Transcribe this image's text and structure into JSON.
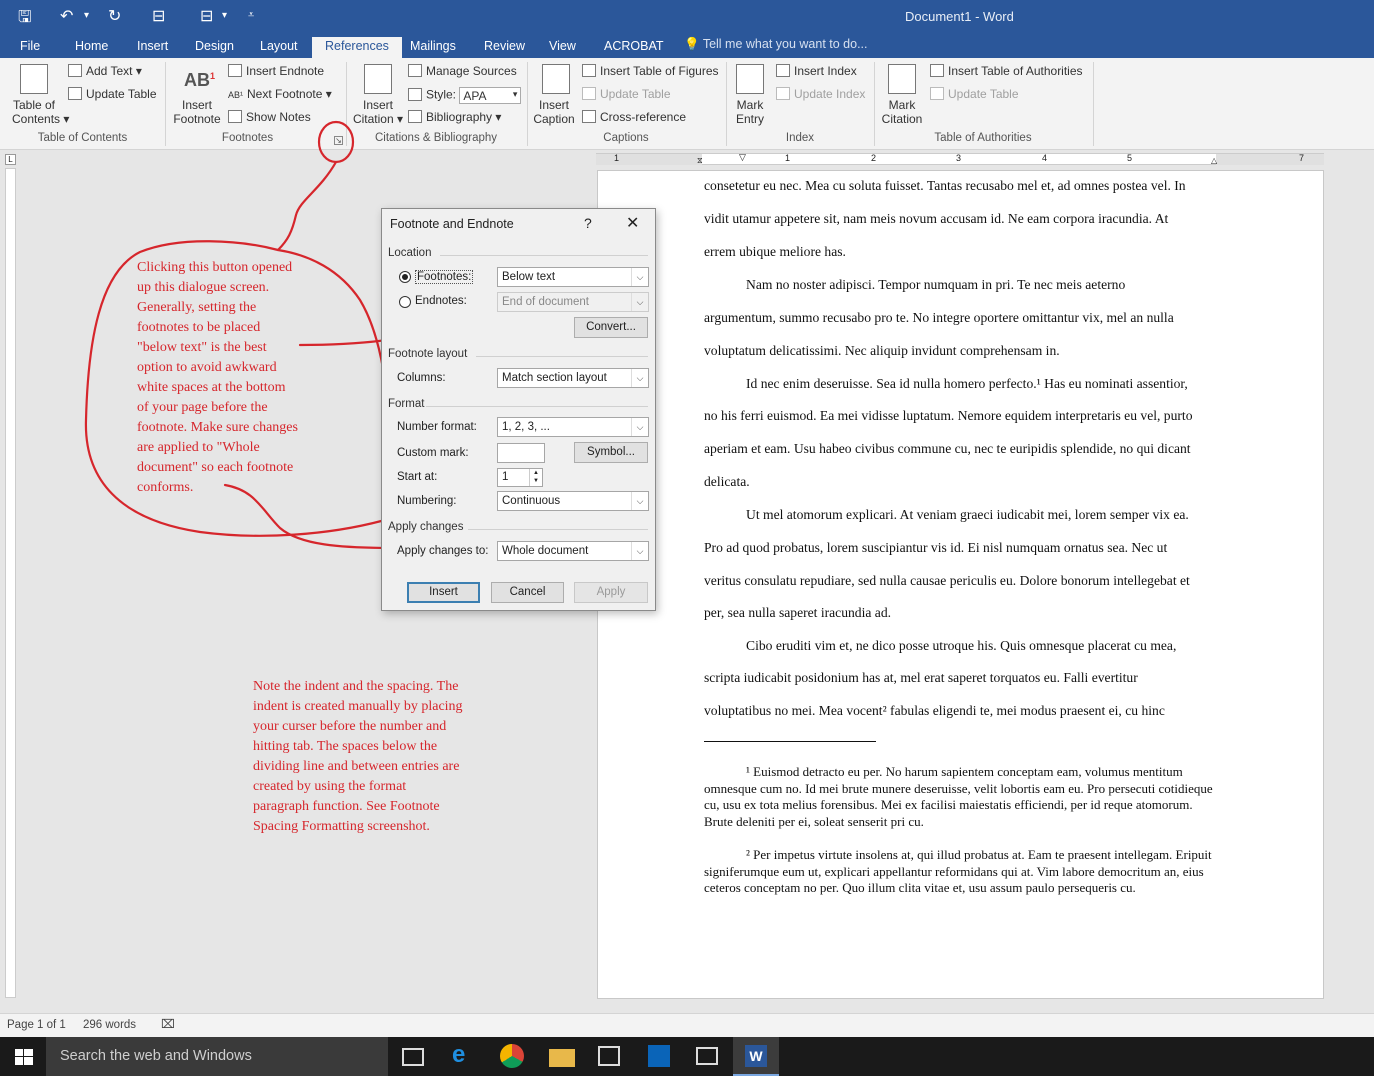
{
  "window": {
    "title": "Document1 - Word"
  },
  "menu_tabs": [
    "File",
    "Home",
    "Insert",
    "Design",
    "Layout",
    "References",
    "Mailings",
    "Review",
    "View",
    "ACROBAT"
  ],
  "active_tab": "References",
  "tell_me": "Tell me what you want to do...",
  "ribbon": {
    "toc": {
      "line1": "Table of",
      "line2": "Contents",
      "add_text": "Add Text",
      "update_table": "Update Table",
      "group": "Table of Contents"
    },
    "footnotes": {
      "insert_line1": "Insert",
      "insert_line2": "Footnote",
      "insert_endnote": "Insert Endnote",
      "next_footnote": "Next Footnote",
      "show_notes": "Show Notes",
      "group": "Footnotes"
    },
    "citations": {
      "insert_line1": "Insert",
      "insert_line2": "Citation",
      "manage_sources": "Manage Sources",
      "style_label": "Style:",
      "style_value": "APA",
      "bibliography": "Bibliography",
      "group": "Citations & Bibliography"
    },
    "captions": {
      "insert_line1": "Insert",
      "insert_line2": "Caption",
      "insert_tof": "Insert Table of Figures",
      "update_table": "Update Table",
      "cross_reference": "Cross-reference",
      "group": "Captions"
    },
    "index": {
      "mark_line1": "Mark",
      "mark_line2": "Entry",
      "insert_index": "Insert Index",
      "update_index": "Update Index",
      "group": "Index"
    },
    "toa": {
      "mark_line1": "Mark",
      "mark_line2": "Citation",
      "insert_toa": "Insert Table of Authorities",
      "update_table": "Update Table",
      "group": "Table of Authorities"
    }
  },
  "ruler_numbers": [
    "1",
    "1",
    "2",
    "3",
    "4",
    "5",
    "7"
  ],
  "dialog": {
    "title": "Footnote and Endnote",
    "help": "?",
    "close": "✕",
    "location_label": "Location",
    "footnotes_label": "Footnotes:",
    "footnotes_value": "Below text",
    "endnotes_label": "Endnotes:",
    "endnotes_value": "End of document",
    "convert_button": "Convert...",
    "layout_label": "Footnote layout",
    "columns_label": "Columns:",
    "columns_value": "Match section layout",
    "format_label": "Format",
    "number_format_label": "Number format:",
    "number_format_value": "1, 2, 3, ...",
    "custom_mark_label": "Custom mark:",
    "custom_mark_value": "",
    "symbol_button": "Symbol...",
    "start_at_label": "Start at:",
    "start_at_value": "1",
    "numbering_label": "Numbering:",
    "numbering_value": "Continuous",
    "apply_changes_label": "Apply changes",
    "apply_to_label": "Apply changes to:",
    "apply_to_value": "Whole document",
    "insert_button": "Insert",
    "cancel_button": "Cancel",
    "apply_button": "Apply"
  },
  "document": {
    "lines": [
      "consetetur eu nec. Mea cu soluta fuisset. Tantas recusabo mel et, ad omnes postea vel. In",
      "vidit utamur appetere sit, nam meis novum accusam id. Ne eam corpora iracundia. At",
      "errem ubique meliore has.",
      "Nam no noster adipisci. Tempor numquam in pri. Te nec meis aeterno",
      "argumentum, summo recusabo pro te. No integre oportere omittantur vix, mel an nulla",
      "voluptatum delicatissimi. Nec aliquip invidunt comprehensam in.",
      "Id nec enim deseruisse. Sea id nulla homero perfecto.¹ Has eu nominati assentior,",
      "no his ferri euismod. Ea mei vidisse luptatum. Nemore equidem interpretaris eu vel, purto",
      "aperiam et eam. Usu habeo civibus commune cu, nec te euripidis splendide, no qui dicant",
      "delicata.",
      "Ut mel atomorum explicari. At veniam graeci iudicabit mei, lorem semper vix ea.",
      "Pro ad quod probatus, lorem suscipiantur vis id. Ei nisl numquam ornatus sea. Nec ut",
      "veritus consulatu repudiare, sed nulla causae periculis eu. Dolore bonorum intellegebat et",
      "per, sea nulla saperet iracundia ad.",
      "Cibo eruditi vim et, ne dico posse utroque his. Quis omnesque placerat cu mea,",
      "scripta iudicabit posidonium has at, mel erat saperet torquatos eu. Falli evertitur",
      "voluptatibus no mei. Mea vocent² fabulas eligendi te, mei modus praesent ei, cu hinc"
    ],
    "footnote1": "¹ Euismod detracto eu per. No harum sapientem conceptam eam, volumus mentitum omnesque cum no. Id mei brute munere deseruisse, velit lobortis eam eu. Pro persecuti cotidieque cu, usu ex tota melius forensibus. Mei ex facilisi maiestatis efficiendi, per id reque atomorum. Brute deleniti per ei, soleat senserit pri cu.",
    "footnote2": "² Per impetus virtute insolens at, qui illud probatus at. Eam te praesent intellegam. Eripuit signiferumque eum ut, explicari appellantur reformidans qui at. Vim labore democritum an, eius ceteros conceptam no per. Quo illum clita vitae et, usu assum paulo persequeris cu."
  },
  "annotations": {
    "note1": [
      "Clicking this button opened",
      "up this dialogue screen.",
      "Generally, setting the",
      "footnotes to be placed",
      "\"below text\" is the best",
      "option to avoid awkward",
      "white spaces at the bottom",
      "of your page before the",
      "footnote.  Make sure changes",
      "are applied to \"Whole",
      "document\" so each footnote",
      "conforms."
    ],
    "note2": [
      "Note the indent and the spacing. The",
      "indent is created manually by placing",
      "your curser before the number and",
      "hitting tab. The spaces below the",
      "dividing line and between entries are",
      "created by using the format",
      "paragraph function. See Footnote",
      "Spacing Formatting screenshot."
    ]
  },
  "status": {
    "page": "Page 1 of 1",
    "words": "296 words"
  },
  "taskbar": {
    "search": "Search the web and Windows"
  },
  "colors": {
    "word_blue": "#2b579a",
    "annotation_red": "#d6262c"
  }
}
